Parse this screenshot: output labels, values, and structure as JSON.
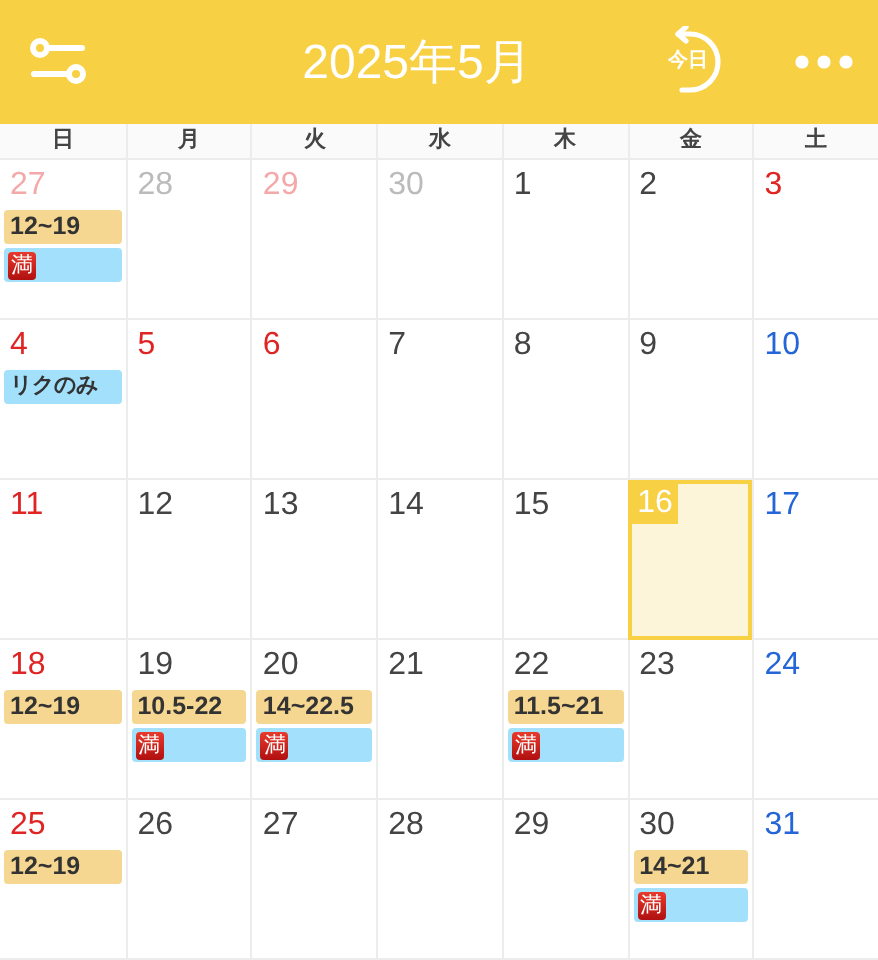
{
  "header": {
    "title": "2025年5月",
    "today_label": "今日"
  },
  "weekdays": [
    "日",
    "月",
    "火",
    "水",
    "木",
    "金",
    "土"
  ],
  "days": [
    {
      "number": "27",
      "color": "#f3a9a9",
      "selected": false,
      "events": [
        {
          "kind": "shift",
          "text": "12~19"
        },
        {
          "kind": "full",
          "badge": "満"
        }
      ]
    },
    {
      "number": "28",
      "color": "#bbbbbb",
      "selected": false
    },
    {
      "number": "29",
      "color": "#f3a9a9",
      "selected": false
    },
    {
      "number": "30",
      "color": "#bbbbbb",
      "selected": false
    },
    {
      "number": "1",
      "color": "#444444",
      "selected": false
    },
    {
      "number": "2",
      "color": "#444444",
      "selected": false
    },
    {
      "number": "3",
      "color": "#e02424",
      "selected": false
    },
    {
      "number": "4",
      "color": "#e02424",
      "selected": false,
      "events": [
        {
          "kind": "note",
          "text": "リクのみ"
        }
      ]
    },
    {
      "number": "5",
      "color": "#e02424",
      "selected": false
    },
    {
      "number": "6",
      "color": "#e02424",
      "selected": false
    },
    {
      "number": "7",
      "color": "#444444",
      "selected": false
    },
    {
      "number": "8",
      "color": "#444444",
      "selected": false
    },
    {
      "number": "9",
      "color": "#444444",
      "selected": false
    },
    {
      "number": "10",
      "color": "#2466d8",
      "selected": false
    },
    {
      "number": "11",
      "color": "#e02424",
      "selected": false
    },
    {
      "number": "12",
      "color": "#444444",
      "selected": false
    },
    {
      "number": "13",
      "color": "#444444",
      "selected": false
    },
    {
      "number": "14",
      "color": "#444444",
      "selected": false
    },
    {
      "number": "15",
      "color": "#444444",
      "selected": false
    },
    {
      "number": "16",
      "color": "#ffffff",
      "selected": true
    },
    {
      "number": "17",
      "color": "#2466d8",
      "selected": false
    },
    {
      "number": "18",
      "color": "#e02424",
      "selected": false,
      "events": [
        {
          "kind": "shift",
          "text": "12~19"
        }
      ]
    },
    {
      "number": "19",
      "color": "#444444",
      "selected": false,
      "events": [
        {
          "kind": "shift",
          "text": "10.5-22"
        },
        {
          "kind": "full",
          "badge": "満"
        }
      ]
    },
    {
      "number": "20",
      "color": "#444444",
      "selected": false,
      "events": [
        {
          "kind": "shift",
          "text": "14~22.5"
        },
        {
          "kind": "full",
          "badge": "満"
        }
      ]
    },
    {
      "number": "21",
      "color": "#444444",
      "selected": false
    },
    {
      "number": "22",
      "color": "#444444",
      "selected": false,
      "events": [
        {
          "kind": "shift",
          "text": "11.5~21"
        },
        {
          "kind": "full",
          "badge": "満"
        }
      ]
    },
    {
      "number": "23",
      "color": "#444444",
      "selected": false
    },
    {
      "number": "24",
      "color": "#2466d8",
      "selected": false
    },
    {
      "number": "25",
      "color": "#e02424",
      "selected": false,
      "events": [
        {
          "kind": "shift",
          "text": "12~19"
        }
      ]
    },
    {
      "number": "26",
      "color": "#444444",
      "selected": false
    },
    {
      "number": "27",
      "color": "#444444",
      "selected": false
    },
    {
      "number": "28",
      "color": "#444444",
      "selected": false
    },
    {
      "number": "29",
      "color": "#444444",
      "selected": false
    },
    {
      "number": "30",
      "color": "#444444",
      "selected": false,
      "events": [
        {
          "kind": "shift",
          "text": "14~21"
        },
        {
          "kind": "full",
          "badge": "満"
        }
      ]
    },
    {
      "number": "31",
      "color": "#2466d8",
      "selected": false
    }
  ]
}
